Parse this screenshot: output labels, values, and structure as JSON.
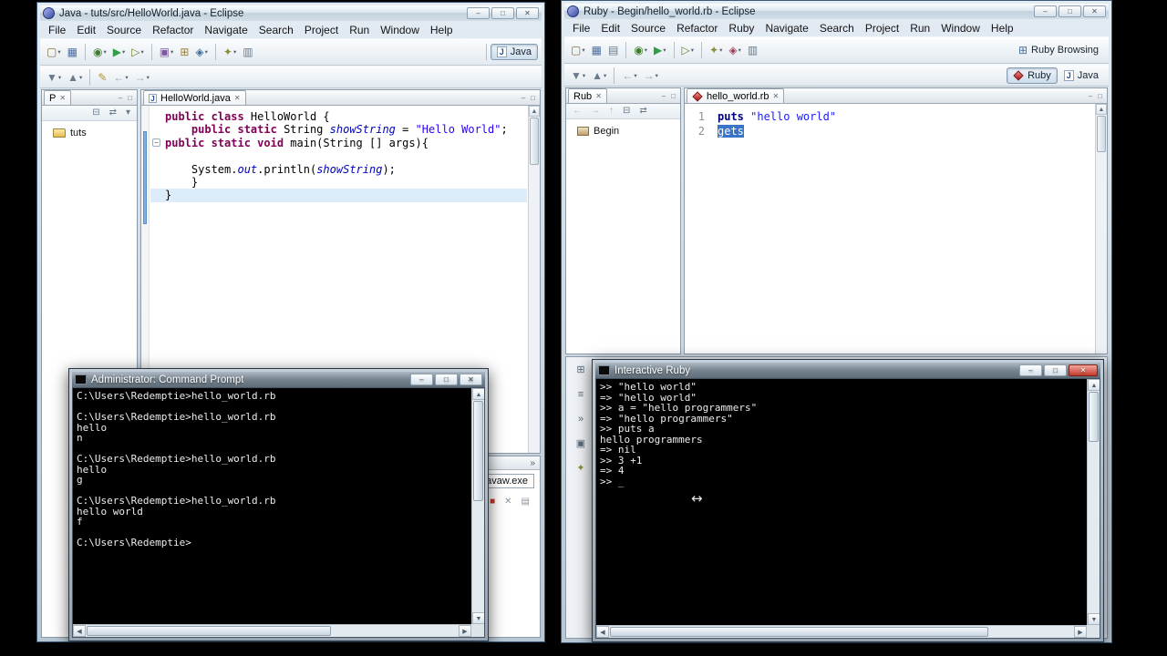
{
  "chrome": {
    "minimize": "–",
    "maximize": "□",
    "close": "✕",
    "overflow": "»",
    "dropdown": "▾",
    "scroll_up": "▲",
    "scroll_down": "▼",
    "scroll_left": "◀",
    "scroll_right": "▶",
    "fold": "−",
    "resize_cursor": "↔"
  },
  "left_window": {
    "title": "Java - tuts/src/HelloWorld.java - Eclipse",
    "menus": [
      "File",
      "Edit",
      "Source",
      "Refactor",
      "Navigate",
      "Search",
      "Project",
      "Run",
      "Window",
      "Help"
    ],
    "toolbar_main": [
      {
        "name": "new-wizard",
        "g": "▢",
        "c": "#8a6d3b",
        "dd": true
      },
      {
        "name": "save",
        "g": "▦",
        "c": "#4a6da0"
      },
      {
        "sep": true
      },
      {
        "name": "debug",
        "g": "◉",
        "c": "#3f7d2e",
        "dd": true
      },
      {
        "name": "run",
        "g": "▶",
        "c": "#2f9e44",
        "dd": true
      },
      {
        "name": "run-last-launched",
        "g": "▷",
        "c": "#6a7d2e",
        "dd": true
      },
      {
        "sep": true
      },
      {
        "name": "new-java-project",
        "g": "▣",
        "c": "#7d5a9e",
        "dd": true
      },
      {
        "name": "new-package",
        "g": "⊞",
        "c": "#9a7d3b"
      },
      {
        "name": "new-class",
        "g": "◈",
        "c": "#3f6d9e",
        "dd": true
      },
      {
        "sep": true
      },
      {
        "name": "search",
        "g": "✦",
        "c": "#8a8d3b",
        "dd": true
      },
      {
        "name": "task",
        "g": "▥",
        "c": "#6a7a8a"
      }
    ],
    "toolbar_nav": [
      {
        "name": "next-annotation",
        "g": "▼",
        "c": "#6a7a8a",
        "dd": true
      },
      {
        "name": "prev-annotation",
        "g": "▲",
        "c": "#6a7a8a",
        "dd": true
      },
      {
        "sep": true
      },
      {
        "name": "last-edit-location",
        "g": "✎",
        "c": "#b8952e"
      },
      {
        "name": "back",
        "g": "←",
        "c": "#9aa4ae",
        "dd": true
      },
      {
        "name": "forward",
        "g": "→",
        "c": "#9aa4ae",
        "dd": true
      }
    ],
    "perspective": {
      "label": "Java",
      "glyph": "J"
    },
    "explorer": {
      "tab": "P",
      "toolbar": [
        {
          "name": "collapse-all",
          "g": "⊟",
          "c": "#6a7a8a"
        },
        {
          "name": "link-with-editor",
          "g": "⇄",
          "c": "#6a7a8a"
        },
        {
          "name": "view-menu",
          "g": "▾",
          "c": "#6a7a8a"
        }
      ],
      "items": [
        {
          "label": "tuts",
          "icon": "folder"
        }
      ]
    },
    "editor": {
      "tab": "HelloWorld.java",
      "file_glyph": "J",
      "lines": [
        {
          "tokens": [
            {
              "t": "public class ",
              "c": "kw"
            },
            {
              "t": "HelloWorld {",
              "c": "pl"
            }
          ]
        },
        {
          "tokens": [
            {
              "t": "    ",
              "c": "pl"
            },
            {
              "t": "public static ",
              "c": "kw"
            },
            {
              "t": "String ",
              "c": "pl"
            },
            {
              "t": "showString",
              "c": "fld"
            },
            {
              "t": " = ",
              "c": "pl"
            },
            {
              "t": "\"Hello World\"",
              "c": "str"
            },
            {
              "t": ";",
              "c": "pl"
            }
          ]
        },
        {
          "fold": true,
          "tokens": [
            {
              "t": "public static void ",
              "c": "kw"
            },
            {
              "t": "main(String [] args){",
              "c": "pl"
            }
          ]
        },
        {
          "tokens": []
        },
        {
          "tokens": [
            {
              "t": "    System.",
              "c": "pl"
            },
            {
              "t": "out",
              "c": "fld"
            },
            {
              "t": ".println(",
              "c": "pl"
            },
            {
              "t": "showString",
              "c": "fld"
            },
            {
              "t": ");",
              "c": "pl"
            }
          ]
        },
        {
          "tokens": [
            {
              "t": "    }",
              "c": "pl"
            }
          ]
        },
        {
          "cur": true,
          "tokens": [
            {
              "t": "}",
              "c": "pl"
            }
          ]
        }
      ]
    },
    "console": {
      "label": "javaw.exe",
      "icons": [
        {
          "name": "terminate",
          "g": "■",
          "c": "#c0392b"
        },
        {
          "name": "remove-launch",
          "g": "✕",
          "c": "#8a949e"
        },
        {
          "name": "clear-console",
          "g": "▤",
          "c": "#8a949e"
        }
      ]
    }
  },
  "right_window": {
    "title": "Ruby - Begin/hello_world.rb - Eclipse",
    "menus": [
      "File",
      "Edit",
      "Source",
      "Refactor",
      "Ruby",
      "Navigate",
      "Search",
      "Project",
      "Run",
      "Window",
      "Help"
    ],
    "toolbar_main": [
      {
        "name": "new-wizard",
        "g": "▢",
        "c": "#8a6d3b",
        "dd": true
      },
      {
        "name": "save",
        "g": "▦",
        "c": "#4a6da0"
      },
      {
        "name": "print",
        "g": "▤",
        "c": "#6a7a8a"
      },
      {
        "sep": true
      },
      {
        "name": "debug",
        "g": "◉",
        "c": "#3f7d2e",
        "dd": true
      },
      {
        "name": "run",
        "g": "▶",
        "c": "#2f9e44",
        "dd": true
      },
      {
        "sep": true
      },
      {
        "name": "external-tools",
        "g": "▷",
        "c": "#6a7d2e",
        "dd": true
      },
      {
        "sep": true
      },
      {
        "name": "search",
        "g": "✦",
        "c": "#8a8d3b",
        "dd": true
      },
      {
        "name": "new-ruby-class",
        "g": "◈",
        "c": "#9e3f5a",
        "dd": true
      },
      {
        "name": "toggle-mark",
        "g": "▥",
        "c": "#6a7a8a"
      }
    ],
    "toolbar_nav": [
      {
        "name": "next-annotation",
        "g": "▼",
        "c": "#6a7a8a",
        "dd": true
      },
      {
        "name": "prev-annotation",
        "g": "▲",
        "c": "#6a7a8a",
        "dd": true
      },
      {
        "sep": true
      },
      {
        "name": "back",
        "g": "←",
        "c": "#9aa4ae",
        "dd": true
      },
      {
        "name": "forward",
        "g": "→",
        "c": "#9aa4ae",
        "dd": true
      }
    ],
    "perspectives": {
      "browsing_label": "Ruby Browsing",
      "ruby_label": "Ruby",
      "java_label": "Java",
      "java_glyph": "J",
      "browsing_glyph": "⊞"
    },
    "explorer": {
      "tab": "Rub",
      "toolbar": [
        {
          "name": "back",
          "g": "←",
          "c": "#aab4be"
        },
        {
          "name": "forward",
          "g": "→",
          "c": "#aab4be"
        },
        {
          "name": "up",
          "g": "↑",
          "c": "#aab4be"
        },
        {
          "name": "collapse-all",
          "g": "⊟",
          "c": "#6a7a8a"
        },
        {
          "name": "link-with-editor",
          "g": "⇄",
          "c": "#6a7a8a"
        }
      ],
      "items": [
        {
          "label": "Begin",
          "icon": "package"
        }
      ]
    },
    "editor": {
      "tab": "hello_world.rb",
      "lines": [
        {
          "num": "1",
          "tokens": [
            {
              "t": "puts ",
              "c": "rkw"
            },
            {
              "t": "\"hello world\"",
              "c": "rstr"
            }
          ]
        },
        {
          "num": "2",
          "tokens": [
            {
              "t": "gets",
              "c": "sel"
            }
          ]
        }
      ]
    },
    "bottom_icons": [
      {
        "name": "problems-view",
        "g": "⊞",
        "c": "#5a6a7a"
      },
      {
        "name": "tasks-view",
        "g": "≡",
        "c": "#5a6a7a"
      },
      {
        "name": "view-overflow",
        "g": "»",
        "c": "#5a6a7a"
      },
      {
        "name": "console-view",
        "g": "▣",
        "c": "#5a6a7a"
      },
      {
        "name": "search-view",
        "g": "✦",
        "c": "#8a8d3b"
      }
    ]
  },
  "cmd": {
    "title": "Administrator: Command Prompt",
    "lines": [
      "C:\\Users\\Redemptie>hello_world.rb",
      "",
      "C:\\Users\\Redemptie>hello_world.rb",
      "hello",
      "n",
      "",
      "C:\\Users\\Redemptie>hello_world.rb",
      "hello",
      "g",
      "",
      "C:\\Users\\Redemptie>hello_world.rb",
      "hello world",
      "f",
      "",
      "C:\\Users\\Redemptie>"
    ]
  },
  "irb": {
    "title": "Interactive Ruby",
    "lines": [
      ">> \"hello world\"",
      "=> \"hello world\"",
      ">> a = \"hello programmers\"",
      "=> \"hello programmers\"",
      ">> puts a",
      "hello programmers",
      "=> nil",
      ">> 3 +1",
      "=> 4",
      ">> _"
    ]
  }
}
